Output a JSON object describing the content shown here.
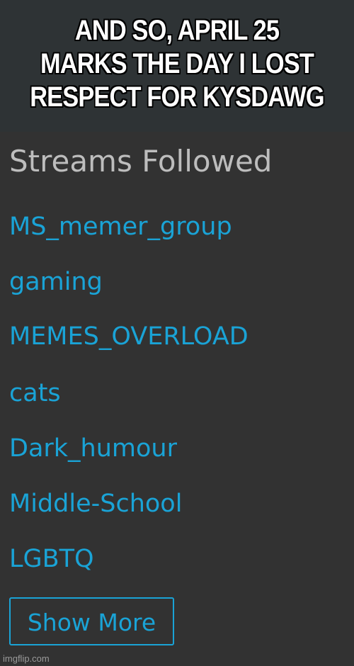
{
  "meme": {
    "caption_lines": [
      "AND SO, APRIL 25",
      "MARKS THE DAY I LOST",
      "RESPECT FOR KYSDAWG"
    ]
  },
  "panel": {
    "title": "Streams Followed",
    "streams": [
      "MS_memer_group",
      "gaming",
      "MEMES_OVERLOAD",
      "cats",
      "Dark_humour",
      "Middle-School",
      "LGBTQ"
    ],
    "show_more_label": "Show More"
  },
  "watermark": "imgflip.com",
  "colors": {
    "link": "#1aa3d6",
    "title": "#bdbdbd",
    "background": "#323232",
    "caption_bar": "#2e3335"
  }
}
